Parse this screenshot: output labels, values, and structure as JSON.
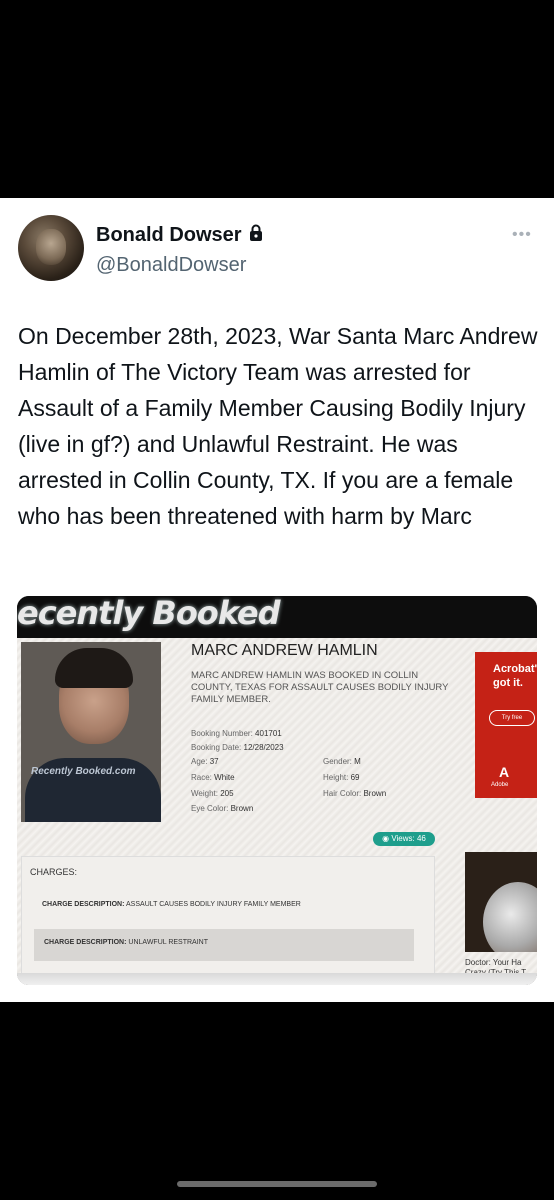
{
  "user": {
    "display_name": "Bonald Dowser",
    "handle": "@BonaldDowser",
    "more_label": "•••"
  },
  "tweet": {
    "text": "On December 28th, 2023, War Santa Marc Andrew Hamlin of The Victory Team was arrested for Assault of a Family Member Causing Bodily Injury (live in gf?) and Unlawful Restraint. He was arrested in Collin County, TX. If you are a female who has been threatened with harm by Marc"
  },
  "screenshot": {
    "banner": "ecently Booked",
    "photo_watermark": "Recently Booked.com",
    "record": {
      "name": "MARC ANDREW HAMLIN",
      "summary": "MARC ANDREW HAMLIN WAS BOOKED IN COLLIN COUNTY, TEXAS FOR ASSAULT CAUSES BODILY INJURY FAMILY MEMBER.",
      "fields": {
        "booking_number_label": "Booking Number:",
        "booking_number": "401701",
        "booking_date_label": "Booking Date:",
        "booking_date": "12/28/2023",
        "age_label": "Age:",
        "age": "37",
        "race_label": "Race:",
        "race": "White",
        "weight_label": "Weight:",
        "weight": "205",
        "eye_label": "Eye Color:",
        "eye": "Brown",
        "gender_label": "Gender:",
        "gender": "M",
        "height_label": "Height:",
        "height": "69",
        "hair_label": "Hair Color:",
        "hair": "Brown"
      },
      "views": "Views: 46"
    },
    "charges": {
      "heading": "CHARGES:",
      "items": [
        {
          "label": "CHARGE DESCRIPTION:",
          "value": "ASSAULT CAUSES BODILY INJURY FAMILY MEMBER"
        },
        {
          "label": "CHARGE DESCRIPTION:",
          "value": "UNLAWFUL RESTRAINT"
        }
      ]
    },
    "ad": {
      "line1": "Acrobat'",
      "line2": "got it.",
      "button": "Try free",
      "logo_label": "Adobe"
    },
    "side_caption_1": "Doctor: Your Ha",
    "side_caption_2": "Crazy (Try This T"
  },
  "colors": {
    "background": "#000000",
    "card": "#ffffff",
    "views_badge": "#1e9e8c",
    "ad_red": "#c52216"
  }
}
